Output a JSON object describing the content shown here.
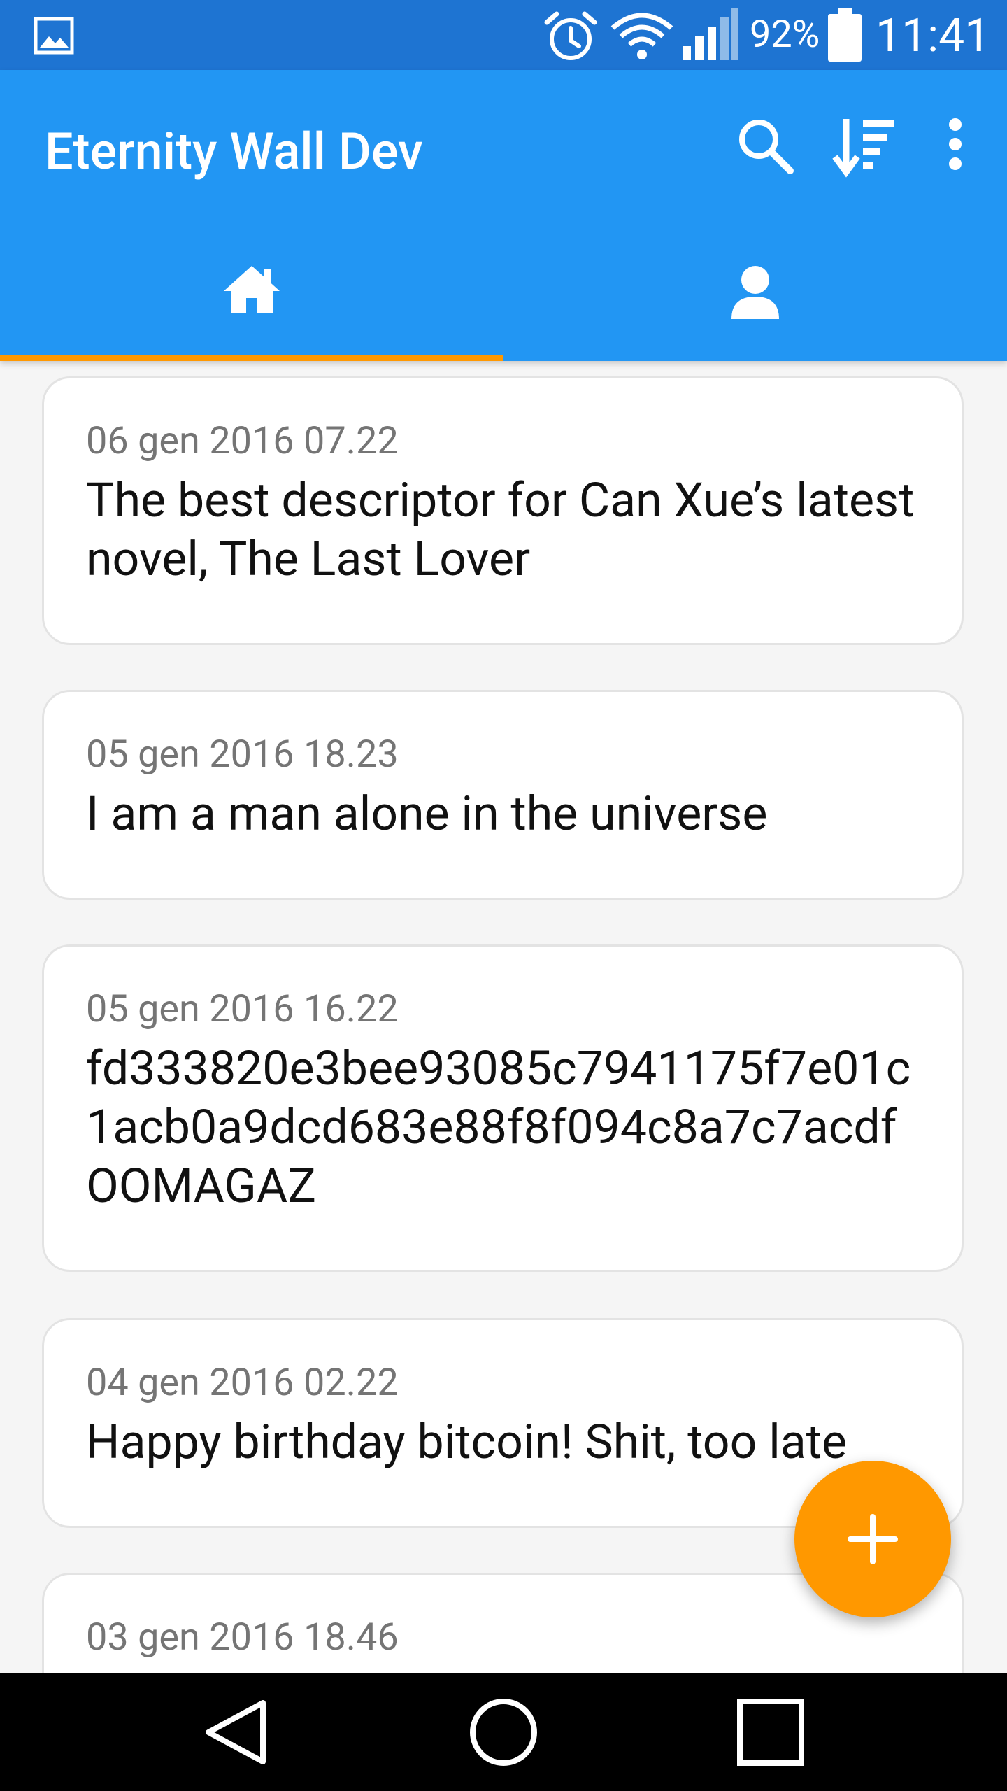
{
  "status_bar": {
    "battery_percent": "92%",
    "time": "11:41",
    "icons": [
      "gallery-icon",
      "alarm-icon",
      "wifi-icon",
      "signal-icon",
      "battery-icon"
    ]
  },
  "app_bar": {
    "title": "Eternity Wall Dev",
    "actions": [
      "search-icon",
      "sort-icon",
      "more-vert-icon"
    ]
  },
  "tabs": [
    {
      "icon": "home-icon",
      "selected": true
    },
    {
      "icon": "user-icon",
      "selected": false
    }
  ],
  "messages": [
    {
      "date": "06 gen 2016 07.22",
      "text": "The best descriptor for Can Xue’s latest novel, The Last Lover"
    },
    {
      "date": "05 gen 2016 18.23",
      "text": "I am a man alone in the universe"
    },
    {
      "date": "05 gen 2016 16.22",
      "text": "fd333820e3bee93085c7941175f7e01c1acb0a9dcd683e88f8f094c8a7c7acdf OOMAGAZ"
    },
    {
      "date": "04 gen 2016 02.22",
      "text": "Happy birthday bitcoin! Shit, too late"
    },
    {
      "date": "03 gen 2016 18.46",
      "text": ""
    }
  ],
  "fab": {
    "icon": "plus-icon"
  },
  "nav_bar": [
    "back-icon",
    "home-circle-icon",
    "recents-icon"
  ],
  "colors": {
    "status_bar": "#1e74d2",
    "primary": "#2296f3",
    "accent": "#ff9800",
    "background": "#f5f5f5"
  }
}
